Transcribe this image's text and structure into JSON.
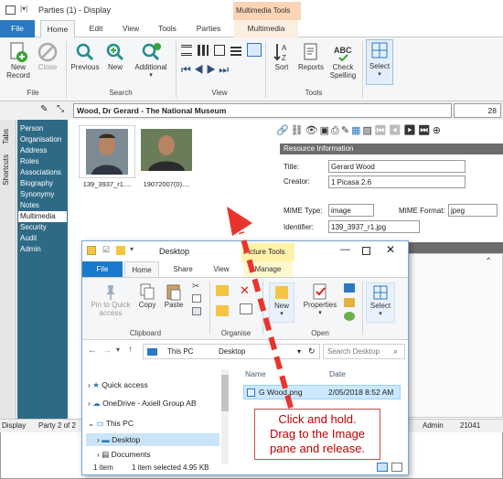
{
  "window": {
    "title": "Parties (1) - Display",
    "contextual_tab": "Multimedia Tools"
  },
  "ribbon_tabs": [
    "File",
    "Home",
    "Edit",
    "View",
    "Tools",
    "Parties",
    "Multimedia"
  ],
  "ribbon": {
    "record": {
      "new": "New",
      "new2": "Record",
      "close": "Close",
      "group": "File"
    },
    "search": {
      "previous": "Previous",
      "new": "New",
      "additional": "Additional",
      "group": "Search"
    },
    "view": {
      "group": "View"
    },
    "tools": {
      "sort": "Sort",
      "reports": "Reports",
      "check": "Check",
      "spelling": "Spelling",
      "group": "Tools"
    },
    "select": {
      "label": "Select"
    }
  },
  "navbar": {
    "record_title": "Wood, Dr Gerard - The National Museum",
    "count": "28"
  },
  "side_tabs": {
    "tabs": "Tabs",
    "shortcuts": "Shortcuts"
  },
  "sidelist": [
    "Person",
    "Organisation",
    "Address",
    "Roles",
    "Associations",
    "Biography",
    "Synonymy",
    "Notes",
    "Multimedia",
    "Security",
    "Audit",
    "Admin"
  ],
  "thumbnails": [
    {
      "caption": "139_3937_r1...."
    },
    {
      "caption": "19072007(0)...."
    }
  ],
  "resource": {
    "header": "Resource Information",
    "title_label": "Title:",
    "title_value": "Gerard Wood",
    "creator_label": "Creator:",
    "creator_value": "1 Picasa 2.6",
    "mime_type_label": "MIME Type:",
    "mime_type_value": "image",
    "mime_format_label": "MIME Format:",
    "mime_format_value": "jpeg",
    "identifier_label": "Identifier:",
    "identifier_value": "139_3937_r1.jpg"
  },
  "status": {
    "mode": "Display",
    "party": "Party 2 of 2",
    "user": "Admin",
    "number": "21041"
  },
  "explorer": {
    "title": "Desktop",
    "contextual_tab": "Picture Tools",
    "tabs": [
      "File",
      "Home",
      "Share",
      "View",
      "Manage"
    ],
    "buttons": {
      "pin": "Pin to Quick",
      "pin2": "access",
      "copy": "Copy",
      "paste": "Paste",
      "new": "New",
      "properties": "Properties",
      "select": "Select"
    },
    "groups": {
      "clipboard": "Clipboard",
      "organise": "Organise",
      "open": "Open"
    },
    "address": {
      "this_pc": "This PC",
      "desktop": "Desktop",
      "search_placeholder": "Search Desktop"
    },
    "nav": [
      "Quick access",
      "OneDrive - Axiell Group AB",
      "This PC",
      "Desktop",
      "Documents"
    ],
    "columns": {
      "name": "Name",
      "date": "Date"
    },
    "file": {
      "name": "G Wood.png",
      "date": "2/05/2018 8:52 AM"
    },
    "status": {
      "items": "1 item",
      "selected": "1 item selected  4.95 KB"
    }
  },
  "callout": {
    "line1": "Click and hold.",
    "line2": "Drag to the Image",
    "line3": "pane and release."
  },
  "colors": {
    "accent": "#2b79c2",
    "sidebar": "#2e6a86",
    "contextual": "#fbd5b5",
    "arrow": "#e8342c"
  }
}
